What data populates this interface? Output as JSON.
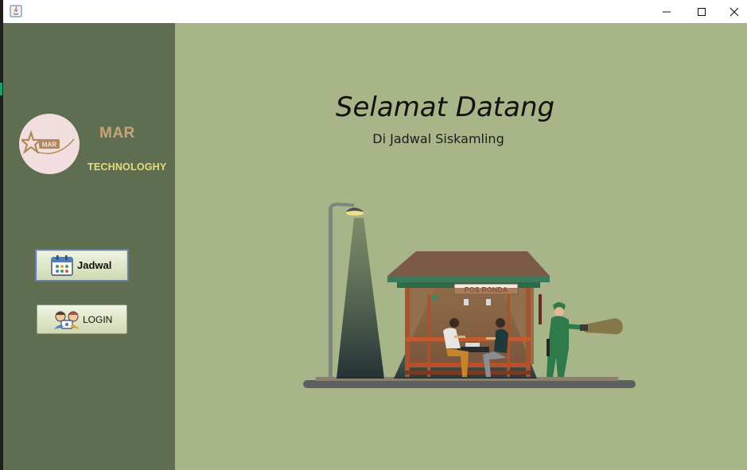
{
  "window": {
    "colors": {
      "sidebar": "#5f6e50",
      "content": "#a8b588",
      "titlebar": "#ffffff"
    }
  },
  "sidebar": {
    "brand_name": "MAR",
    "brand_tagline": "TECHNOLOGHY",
    "logo_text": "MAR",
    "nav": [
      {
        "label": "Jadwal",
        "icon": "calendar-icon",
        "selected": true
      },
      {
        "label": "LOGIN",
        "icon": "users-icon",
        "selected": false
      }
    ]
  },
  "main": {
    "title": "Selamat Datang",
    "subtitle": "Di Jadwal Siskamling",
    "illustration": {
      "sign_text": "POS RONDA",
      "icons": [
        "crescent-moon-icon",
        "street-lamp-icon",
        "guard-post-icon",
        "security-guard-icon",
        "flashlight-icon"
      ]
    }
  }
}
